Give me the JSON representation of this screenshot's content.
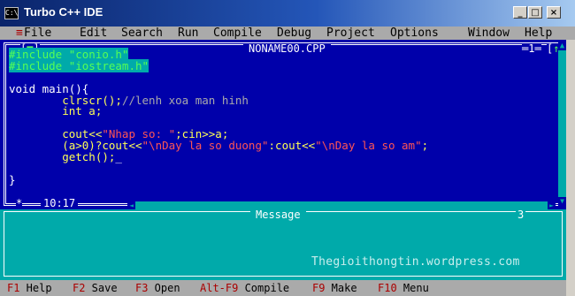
{
  "window": {
    "title": "Turbo C++ IDE",
    "icon_text": "C:\\",
    "buttons": [
      "_",
      "□",
      "×"
    ]
  },
  "menu": {
    "system": "≡",
    "items": [
      "File",
      "Edit",
      "Search",
      "Run",
      "Compile",
      "Debug",
      "Project",
      "Options",
      "Window",
      "Help"
    ]
  },
  "editor": {
    "filename": "NONAME00.CPP",
    "close_box": "[■]",
    "window_number": "1",
    "zoom_box": "[↑]",
    "cursor_position": "10:17",
    "modified_marker": "*",
    "lines": [
      [
        {
          "t": "#include \"conio.h\"",
          "c": "pp"
        }
      ],
      [
        {
          "t": "#include \"iostream.h\"",
          "c": "pp"
        }
      ],
      [
        {
          "t": "",
          "c": ""
        }
      ],
      [
        {
          "t": "void main(){",
          "c": "kw"
        }
      ],
      [
        {
          "t": "        clrscr();",
          "c": ""
        },
        {
          "t": "//lenh xoa man hinh",
          "c": "cmt"
        }
      ],
      [
        {
          "t": "        int a;",
          "c": ""
        }
      ],
      [
        {
          "t": "",
          "c": ""
        }
      ],
      [
        {
          "t": "        cout<<",
          "c": ""
        },
        {
          "t": "\"Nhap so: \"",
          "c": "str"
        },
        {
          "t": ";cin>>a;",
          "c": ""
        }
      ],
      [
        {
          "t": "        (a>0)?cout<<",
          "c": ""
        },
        {
          "t": "\"\\nDay la so duong\"",
          "c": "str"
        },
        {
          "t": ":cout<<",
          "c": ""
        },
        {
          "t": "\"\\nDay la so am\"",
          "c": "str"
        },
        {
          "t": ";",
          "c": ""
        }
      ],
      [
        {
          "t": "        getch();",
          "c": ""
        },
        {
          "t": "_",
          "c": "cursor"
        }
      ],
      [
        {
          "t": "",
          "c": ""
        }
      ],
      [
        {
          "t": "}",
          "c": "kw"
        }
      ]
    ]
  },
  "message": {
    "title": "Message",
    "window_number": "3",
    "watermark": "Thegioithongtin.wordpress.com"
  },
  "statusbar": [
    {
      "key": "F1",
      "label": "Help"
    },
    {
      "key": "F2",
      "label": "Save"
    },
    {
      "key": "F3",
      "label": "Open"
    },
    {
      "key": "Alt-F9",
      "label": "Compile"
    },
    {
      "key": "F9",
      "label": "Make"
    },
    {
      "key": "F10",
      "label": "Menu"
    }
  ],
  "colors": {
    "editor_bg": "#0000aa",
    "code_text": "#ffff55",
    "string": "#ff5555",
    "comment": "#aaaaaa",
    "preprocessor": "#55ff55",
    "message_bg": "#00aaaa",
    "menu_bg": "#aaaaaa"
  }
}
